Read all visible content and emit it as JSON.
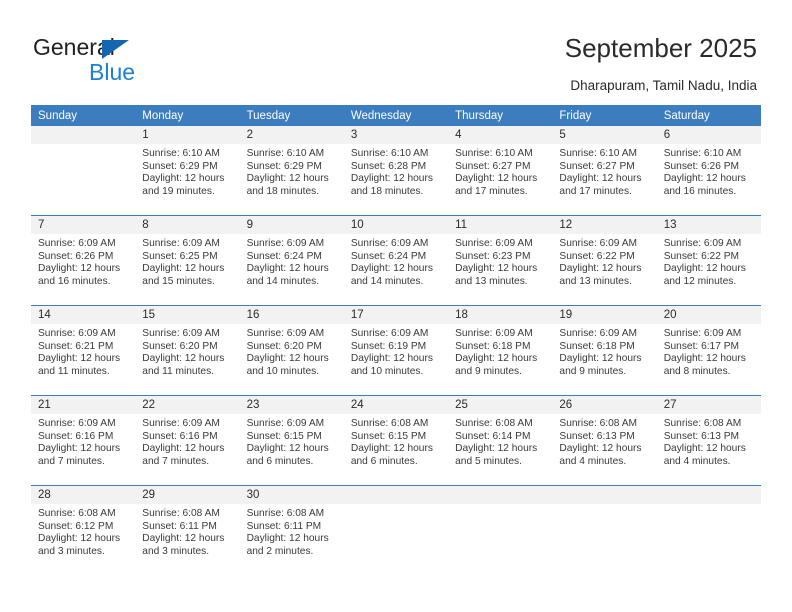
{
  "brand": {
    "name_primary": "General",
    "name_secondary": "Blue",
    "triangle_color": "#1466b0",
    "secondary_color": "#1b82d1"
  },
  "header": {
    "title": "September 2025",
    "subtitle": "Dharapuram, Tamil Nadu, India"
  },
  "theme": {
    "header_bg": "#3b7dbf",
    "daynum_bg": "#f2f2f2",
    "separator": "#3b7dbf",
    "text": "#3a3a3a"
  },
  "columns": [
    "Sunday",
    "Monday",
    "Tuesday",
    "Wednesday",
    "Thursday",
    "Friday",
    "Saturday"
  ],
  "weeks": [
    [
      {
        "day": "",
        "sunrise": "",
        "sunset": "",
        "daylight_1": "",
        "daylight_2": ""
      },
      {
        "day": "1",
        "sunrise": "Sunrise: 6:10 AM",
        "sunset": "Sunset: 6:29 PM",
        "daylight_1": "Daylight: 12 hours",
        "daylight_2": "and 19 minutes."
      },
      {
        "day": "2",
        "sunrise": "Sunrise: 6:10 AM",
        "sunset": "Sunset: 6:29 PM",
        "daylight_1": "Daylight: 12 hours",
        "daylight_2": "and 18 minutes."
      },
      {
        "day": "3",
        "sunrise": "Sunrise: 6:10 AM",
        "sunset": "Sunset: 6:28 PM",
        "daylight_1": "Daylight: 12 hours",
        "daylight_2": "and 18 minutes."
      },
      {
        "day": "4",
        "sunrise": "Sunrise: 6:10 AM",
        "sunset": "Sunset: 6:27 PM",
        "daylight_1": "Daylight: 12 hours",
        "daylight_2": "and 17 minutes."
      },
      {
        "day": "5",
        "sunrise": "Sunrise: 6:10 AM",
        "sunset": "Sunset: 6:27 PM",
        "daylight_1": "Daylight: 12 hours",
        "daylight_2": "and 17 minutes."
      },
      {
        "day": "6",
        "sunrise": "Sunrise: 6:10 AM",
        "sunset": "Sunset: 6:26 PM",
        "daylight_1": "Daylight: 12 hours",
        "daylight_2": "and 16 minutes."
      }
    ],
    [
      {
        "day": "7",
        "sunrise": "Sunrise: 6:09 AM",
        "sunset": "Sunset: 6:26 PM",
        "daylight_1": "Daylight: 12 hours",
        "daylight_2": "and 16 minutes."
      },
      {
        "day": "8",
        "sunrise": "Sunrise: 6:09 AM",
        "sunset": "Sunset: 6:25 PM",
        "daylight_1": "Daylight: 12 hours",
        "daylight_2": "and 15 minutes."
      },
      {
        "day": "9",
        "sunrise": "Sunrise: 6:09 AM",
        "sunset": "Sunset: 6:24 PM",
        "daylight_1": "Daylight: 12 hours",
        "daylight_2": "and 14 minutes."
      },
      {
        "day": "10",
        "sunrise": "Sunrise: 6:09 AM",
        "sunset": "Sunset: 6:24 PM",
        "daylight_1": "Daylight: 12 hours",
        "daylight_2": "and 14 minutes."
      },
      {
        "day": "11",
        "sunrise": "Sunrise: 6:09 AM",
        "sunset": "Sunset: 6:23 PM",
        "daylight_1": "Daylight: 12 hours",
        "daylight_2": "and 13 minutes."
      },
      {
        "day": "12",
        "sunrise": "Sunrise: 6:09 AM",
        "sunset": "Sunset: 6:22 PM",
        "daylight_1": "Daylight: 12 hours",
        "daylight_2": "and 13 minutes."
      },
      {
        "day": "13",
        "sunrise": "Sunrise: 6:09 AM",
        "sunset": "Sunset: 6:22 PM",
        "daylight_1": "Daylight: 12 hours",
        "daylight_2": "and 12 minutes."
      }
    ],
    [
      {
        "day": "14",
        "sunrise": "Sunrise: 6:09 AM",
        "sunset": "Sunset: 6:21 PM",
        "daylight_1": "Daylight: 12 hours",
        "daylight_2": "and 11 minutes."
      },
      {
        "day": "15",
        "sunrise": "Sunrise: 6:09 AM",
        "sunset": "Sunset: 6:20 PM",
        "daylight_1": "Daylight: 12 hours",
        "daylight_2": "and 11 minutes."
      },
      {
        "day": "16",
        "sunrise": "Sunrise: 6:09 AM",
        "sunset": "Sunset: 6:20 PM",
        "daylight_1": "Daylight: 12 hours",
        "daylight_2": "and 10 minutes."
      },
      {
        "day": "17",
        "sunrise": "Sunrise: 6:09 AM",
        "sunset": "Sunset: 6:19 PM",
        "daylight_1": "Daylight: 12 hours",
        "daylight_2": "and 10 minutes."
      },
      {
        "day": "18",
        "sunrise": "Sunrise: 6:09 AM",
        "sunset": "Sunset: 6:18 PM",
        "daylight_1": "Daylight: 12 hours",
        "daylight_2": "and 9 minutes."
      },
      {
        "day": "19",
        "sunrise": "Sunrise: 6:09 AM",
        "sunset": "Sunset: 6:18 PM",
        "daylight_1": "Daylight: 12 hours",
        "daylight_2": "and 9 minutes."
      },
      {
        "day": "20",
        "sunrise": "Sunrise: 6:09 AM",
        "sunset": "Sunset: 6:17 PM",
        "daylight_1": "Daylight: 12 hours",
        "daylight_2": "and 8 minutes."
      }
    ],
    [
      {
        "day": "21",
        "sunrise": "Sunrise: 6:09 AM",
        "sunset": "Sunset: 6:16 PM",
        "daylight_1": "Daylight: 12 hours",
        "daylight_2": "and 7 minutes."
      },
      {
        "day": "22",
        "sunrise": "Sunrise: 6:09 AM",
        "sunset": "Sunset: 6:16 PM",
        "daylight_1": "Daylight: 12 hours",
        "daylight_2": "and 7 minutes."
      },
      {
        "day": "23",
        "sunrise": "Sunrise: 6:09 AM",
        "sunset": "Sunset: 6:15 PM",
        "daylight_1": "Daylight: 12 hours",
        "daylight_2": "and 6 minutes."
      },
      {
        "day": "24",
        "sunrise": "Sunrise: 6:08 AM",
        "sunset": "Sunset: 6:15 PM",
        "daylight_1": "Daylight: 12 hours",
        "daylight_2": "and 6 minutes."
      },
      {
        "day": "25",
        "sunrise": "Sunrise: 6:08 AM",
        "sunset": "Sunset: 6:14 PM",
        "daylight_1": "Daylight: 12 hours",
        "daylight_2": "and 5 minutes."
      },
      {
        "day": "26",
        "sunrise": "Sunrise: 6:08 AM",
        "sunset": "Sunset: 6:13 PM",
        "daylight_1": "Daylight: 12 hours",
        "daylight_2": "and 4 minutes."
      },
      {
        "day": "27",
        "sunrise": "Sunrise: 6:08 AM",
        "sunset": "Sunset: 6:13 PM",
        "daylight_1": "Daylight: 12 hours",
        "daylight_2": "and 4 minutes."
      }
    ],
    [
      {
        "day": "28",
        "sunrise": "Sunrise: 6:08 AM",
        "sunset": "Sunset: 6:12 PM",
        "daylight_1": "Daylight: 12 hours",
        "daylight_2": "and 3 minutes."
      },
      {
        "day": "29",
        "sunrise": "Sunrise: 6:08 AM",
        "sunset": "Sunset: 6:11 PM",
        "daylight_1": "Daylight: 12 hours",
        "daylight_2": "and 3 minutes."
      },
      {
        "day": "30",
        "sunrise": "Sunrise: 6:08 AM",
        "sunset": "Sunset: 6:11 PM",
        "daylight_1": "Daylight: 12 hours",
        "daylight_2": "and 2 minutes."
      },
      {
        "day": "",
        "sunrise": "",
        "sunset": "",
        "daylight_1": "",
        "daylight_2": ""
      },
      {
        "day": "",
        "sunrise": "",
        "sunset": "",
        "daylight_1": "",
        "daylight_2": ""
      },
      {
        "day": "",
        "sunrise": "",
        "sunset": "",
        "daylight_1": "",
        "daylight_2": ""
      },
      {
        "day": "",
        "sunrise": "",
        "sunset": "",
        "daylight_1": "",
        "daylight_2": ""
      }
    ]
  ]
}
